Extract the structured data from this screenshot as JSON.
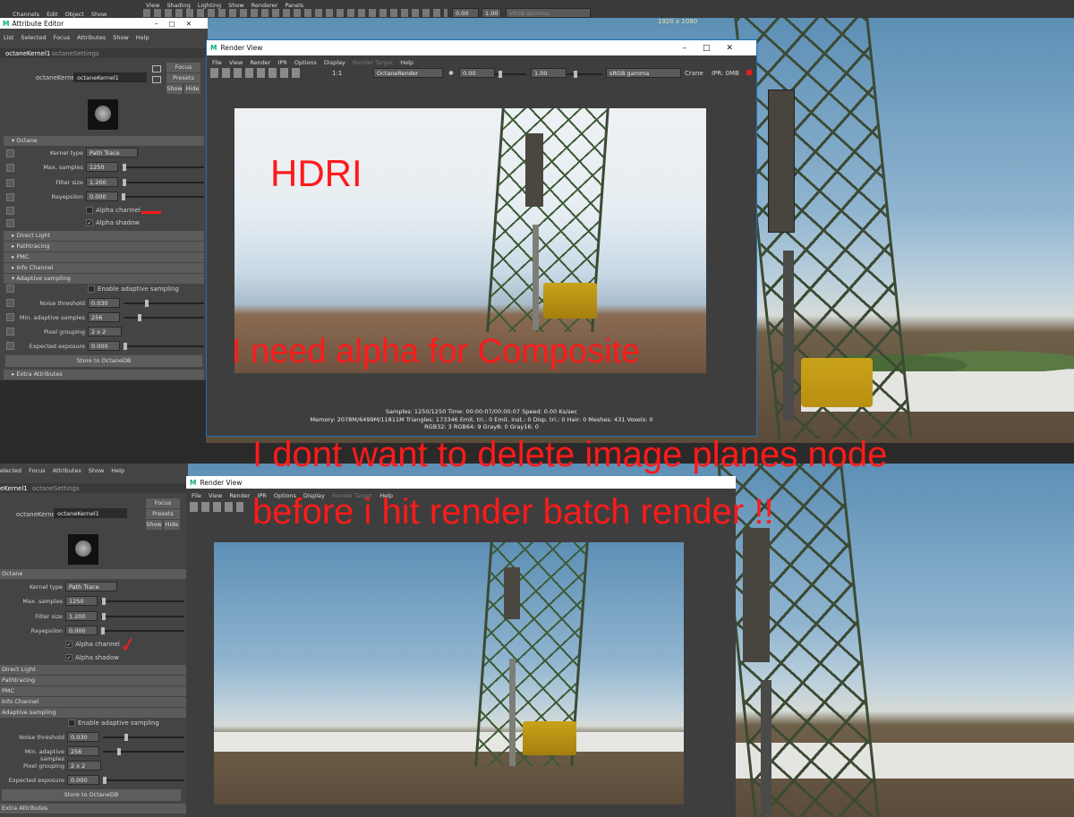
{
  "top_maya_menu": [
    "Channels",
    "Edit",
    "Object",
    "Show"
  ],
  "viewport_menu": [
    "View",
    "Shading",
    "Lighting",
    "Show",
    "Renderer",
    "Panels"
  ],
  "viewport_fields": {
    "a": "0.00",
    "b": "1.00",
    "gamma": "sRGB gamma"
  },
  "resolution": "1920 x 1080",
  "attr_editor": {
    "title": "Attribute Editor",
    "menu": [
      "List",
      "Selected",
      "Focus",
      "Attributes",
      "Show",
      "Help"
    ],
    "tabs": [
      "octaneKernel1",
      "octaneSettings"
    ],
    "node_label": "octaneKernel:",
    "node_value": "octaneKernel1",
    "focus": "Focus",
    "presets": "Presets",
    "show": "Show",
    "hide": "Hide",
    "section": "Octane",
    "kernel_label": "Kernel type",
    "kernel_value": "Path Trace",
    "max_samples_label": "Max. samples",
    "max_samples": "1250",
    "filter_label": "Filter size",
    "filter": "1.200",
    "ray_label": "Rayepsilon",
    "ray": "0.000",
    "alpha_channel": "Alpha channel",
    "alpha_shadow": "Alpha shadow",
    "collapsed": [
      "Direct Light",
      "Pathtracing",
      "PMC",
      "Info Channel"
    ],
    "adaptive": "Adaptive sampling",
    "enable_adaptive": "Enable adaptive sampling",
    "noise_label": "Noise threshold",
    "noise": "0.030",
    "min_adapt_label": "Min. adaptive samples",
    "min_adapt": "256",
    "pixel_label": "Pixel grouping",
    "pixel": "2 x 2",
    "expo_label": "Expected exposure",
    "expo": "0.000",
    "store": "Store to OctaneDB",
    "extra": "Extra Attributes"
  },
  "attr_editor_bottom": {
    "menu": [
      "elected",
      "Focus",
      "Attributes",
      "Show",
      "Help"
    ],
    "tabs": [
      "eKernel1",
      "octaneSettings"
    ],
    "section": "Octane",
    "collapsed": [
      "Direct Light",
      "Pathtracing",
      "PMC",
      "Info Channel"
    ]
  },
  "render_view": {
    "title": "Render View",
    "menu": [
      "File",
      "View",
      "Render",
      "IPR",
      "Options",
      "Display",
      "Render Target",
      "Help"
    ],
    "renderer": "OctaneRender",
    "exposure": "0.00",
    "gamma": "1.00",
    "colorspace": "sRGB gamma",
    "camera": "Crane",
    "ipr": "IPR: 0MB",
    "ratio": "1:1",
    "status1": "Samples: 1250/1250 Time: 00:00:07/00:00:07 Speed: 0.00 Ks/sec",
    "status2": "Memory: 2078M/6499M/11811M Triangles: 173346 Emit. tri.: 0 Emit. inst.: 0 Disp. tri.: 0 Hair: 0 Meshes: 431 Voxels: 0",
    "status3": "RGB32: 3 RGB64: 9 Gray8: 0 Gray16: 0"
  },
  "render_view_bottom": {
    "title": "Render View",
    "menu": [
      "File",
      "View",
      "Render",
      "IPR",
      "Options",
      "Display",
      "Render Target",
      "Help"
    ]
  },
  "annotations": {
    "hdri": "HDRI",
    "need_alpha": "I need alpha for Composite",
    "line1": "I dont want to delete image planes node",
    "line2": "before i hit render batch render !!"
  },
  "colors": {
    "annotation": "#ff1a1a",
    "panel": "#444444"
  }
}
